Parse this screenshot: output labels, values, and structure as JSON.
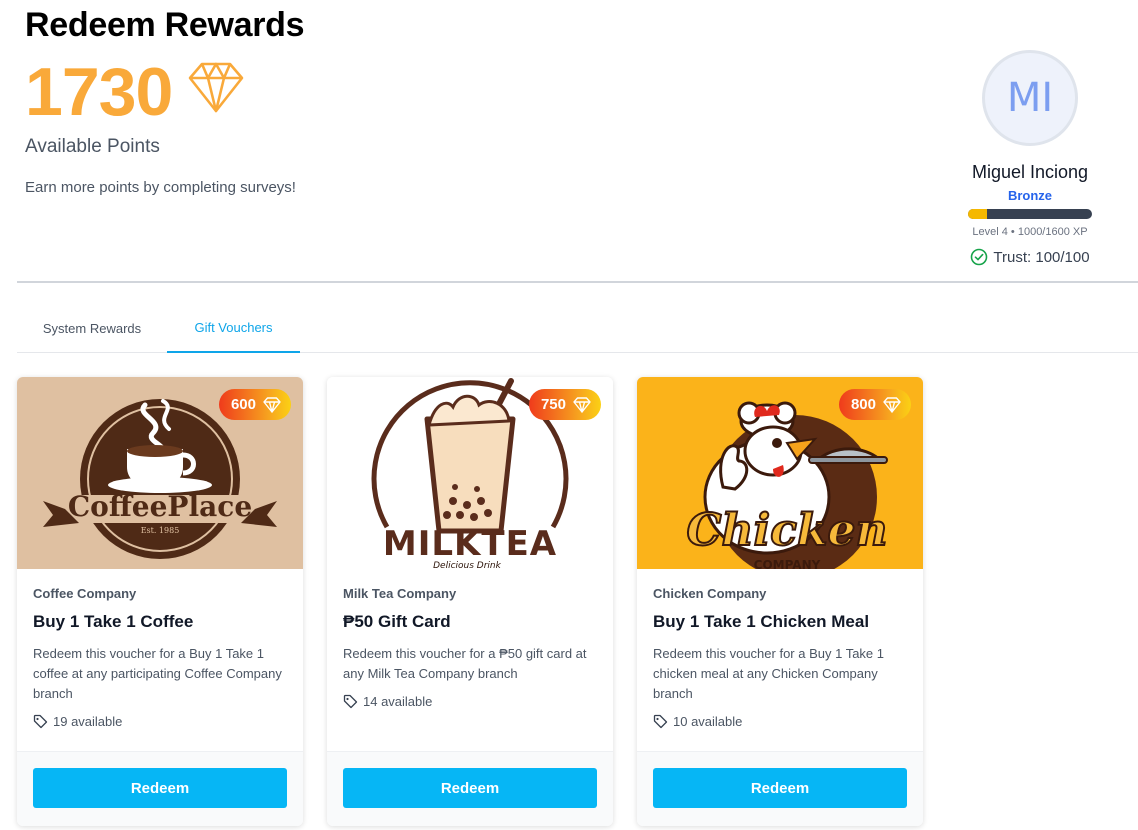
{
  "header": {
    "title": "Redeem Rewards",
    "points": "1730",
    "points_label": "Available Points",
    "hint": "Earn more points by completing surveys!"
  },
  "profile": {
    "initials": "MI",
    "name": "Miguel Inciong",
    "tier": "Bronze",
    "xp_text": "Level 4 • 1000/1600 XP",
    "xp_progress_fraction": 0.15,
    "trust": "Trust: 100/100"
  },
  "tabs": [
    {
      "label": "System Rewards",
      "active": false
    },
    {
      "label": "Gift Vouchers",
      "active": true
    }
  ],
  "vouchers": [
    {
      "points": "600",
      "company": "Coffee Company",
      "title": "Buy 1 Take 1 Coffee",
      "description": "Redeem this voucher for a Buy 1 Take 1 coffee at any participating Coffee Company branch",
      "available": "19 available",
      "button": "Redeem",
      "logo": {
        "brand": "CoffeePlace",
        "tagline": "Est. 1985"
      }
    },
    {
      "points": "750",
      "company": "Milk Tea Company",
      "title": "₱50 Gift Card",
      "description": "Redeem this voucher for a ₱50 gift card at any Milk Tea Company branch",
      "available": "14 available",
      "button": "Redeem",
      "logo": {
        "brand": "MILKTEA",
        "tagline": "Delicious Drink"
      }
    },
    {
      "points": "800",
      "company": "Chicken Company",
      "title": "Buy 1 Take 1 Chicken Meal",
      "description": "Redeem this voucher for a Buy 1 Take 1 chicken meal at any Chicken Company branch",
      "available": "10 available",
      "button": "Redeem",
      "logo": {
        "brand": "Chicken",
        "tagline": "COMPANY"
      }
    }
  ],
  "colors": {
    "points": "#f9a93a",
    "accent": "#06b6f5",
    "tier": "#2563eb",
    "trust_ok": "#16a34a"
  },
  "icons": [
    "diamond-icon",
    "check-circle-icon",
    "tag-icon"
  ]
}
